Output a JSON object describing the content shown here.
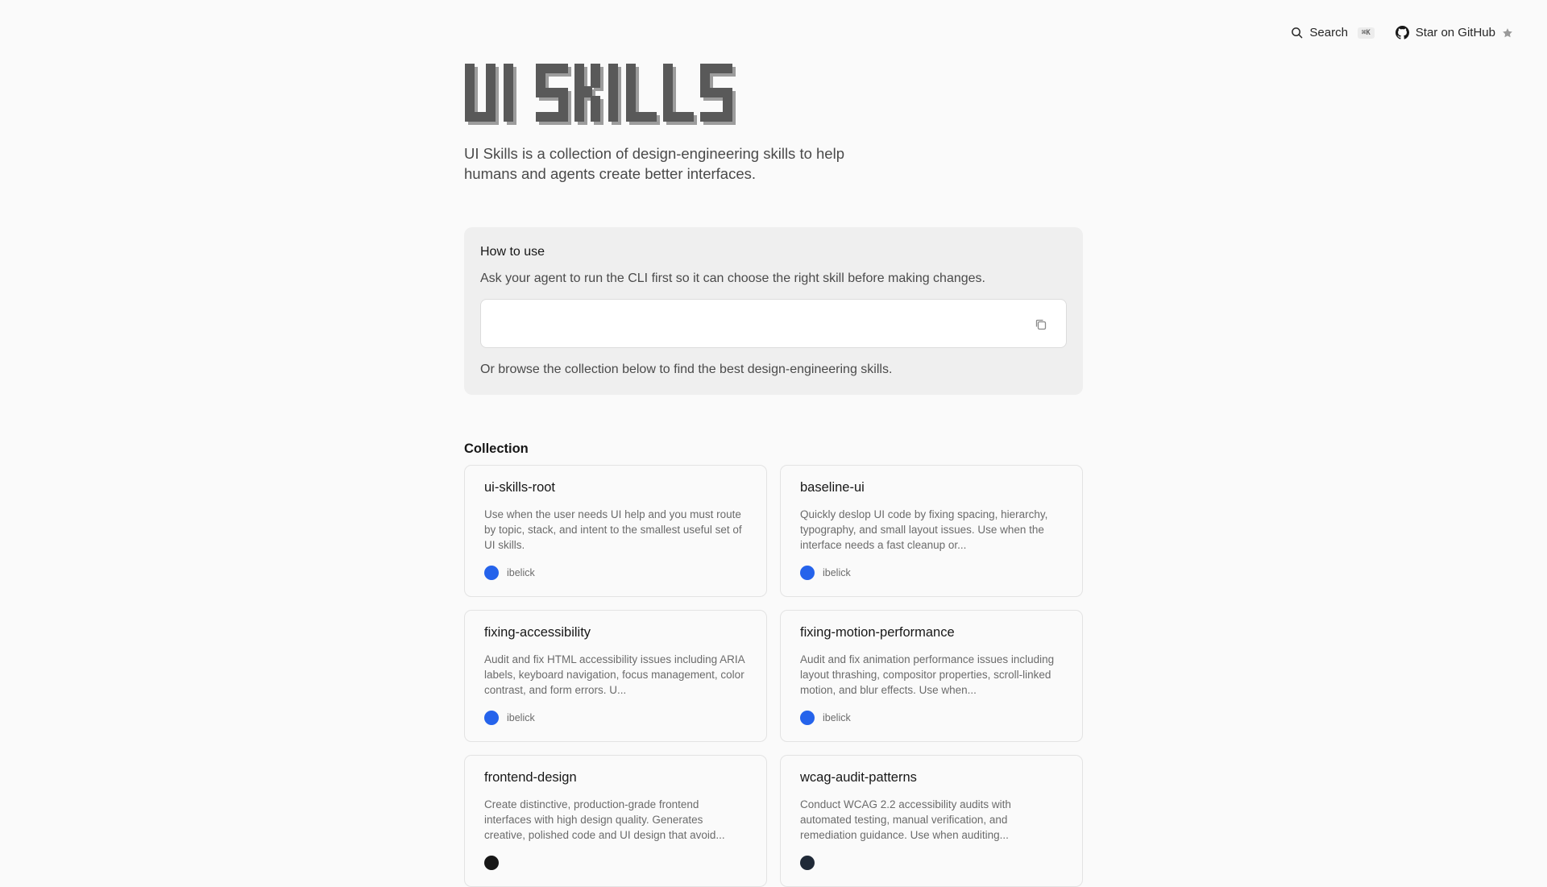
{
  "nav": {
    "search_label": "Search",
    "search_shortcut": "⌘K",
    "github_label": "Star on GitHub"
  },
  "hero": {
    "logo_text": "UI SKILLS",
    "tagline": "UI Skills is a collection of design-engineering skills to help humans and agents create better interfaces."
  },
  "howto": {
    "title": "How to use",
    "intro": "Ask your agent to run the CLI first so it can choose the right skill before making changes.",
    "command": "",
    "outro": "Or browse the collection below to find the best design-engineering skills."
  },
  "collection": {
    "title": "Collection",
    "items": [
      {
        "name": "ui-skills-root",
        "description": "Use when the user needs UI help and you must route by topic, stack, and intent to the smallest useful set of UI skills.",
        "author": "ibelick",
        "avatar_color": "#2563eb"
      },
      {
        "name": "baseline-ui",
        "description": "Quickly deslop UI code by fixing spacing, hierarchy, typography, and small layout issues. Use when the interface needs a fast cleanup or...",
        "author": "ibelick",
        "avatar_color": "#2563eb"
      },
      {
        "name": "fixing-accessibility",
        "description": "Audit and fix HTML accessibility issues including ARIA labels, keyboard navigation, focus management, color contrast, and form errors. U...",
        "author": "ibelick",
        "avatar_color": "#2563eb"
      },
      {
        "name": "fixing-motion-performance",
        "description": "Audit and fix animation performance issues including layout thrashing, compositor properties, scroll-linked motion, and blur effects. Use when...",
        "author": "ibelick",
        "avatar_color": "#2563eb"
      },
      {
        "name": "frontend-design",
        "description": "Create distinctive, production-grade frontend interfaces with high design quality. Generates creative, polished code and UI design that avoid...",
        "author": "",
        "avatar_color": "#171717"
      },
      {
        "name": "wcag-audit-patterns",
        "description": "Conduct WCAG 2.2 accessibility audits with automated testing, manual verification, and remediation guidance. Use when auditing...",
        "author": "",
        "avatar_color": "#1f2937"
      }
    ]
  },
  "colors": {
    "background": "#fafafa",
    "panel": "#efefef",
    "accent_avatar": "#2563eb",
    "logo": "#5a5a5a"
  }
}
